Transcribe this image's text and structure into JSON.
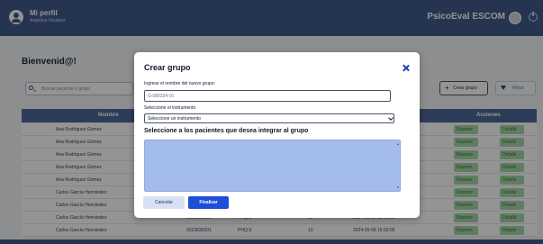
{
  "header": {
    "profile_title": "Mi perfil",
    "profile_subtitle": "Angelica Vazquez",
    "brand": "PsicoEval ESCOM"
  },
  "main": {
    "welcome": "Bienvenid@!",
    "search_placeholder": "Buscar paciente o grupo",
    "create_group_label": "Crear grupo",
    "filter_label": "Filtrar"
  },
  "table": {
    "headers": {
      "name": "Nombre",
      "actions": "Acciones"
    },
    "rows": [
      {
        "name": "Ana Rodríguez Gómez",
        "code": "",
        "instrument": "",
        "count": "",
        "date": "",
        "report": "Reporte",
        "detail": "Detalle"
      },
      {
        "name": "Ana Rodríguez Gómez",
        "code": "",
        "instrument": "",
        "count": "",
        "date": "",
        "report": "Reporte",
        "detail": "Detalle"
      },
      {
        "name": "Ana Rodríguez Gómez",
        "code": "",
        "instrument": "",
        "count": "",
        "date": "",
        "report": "Reporte",
        "detail": "Detalle"
      },
      {
        "name": "Ana Rodríguez Gómez",
        "code": "",
        "instrument": "",
        "count": "",
        "date": "",
        "report": "Reporte",
        "detail": "Detalle"
      },
      {
        "name": "Ana Rodríguez Gómez",
        "code": "",
        "instrument": "",
        "count": "",
        "date": "",
        "report": "Reporte",
        "detail": "Detalle"
      },
      {
        "name": "Carlos García Hernández",
        "code": "",
        "instrument": "",
        "count": "",
        "date": "",
        "report": "Reporte",
        "detail": "Detalle"
      },
      {
        "name": "Carlos García Hernández",
        "code": "",
        "instrument": "",
        "count": "",
        "date": "",
        "report": "Reporte",
        "detail": "Detalle"
      },
      {
        "name": "Carlos García Hernández",
        "code": "2023630001",
        "instrument": "PHQ-9",
        "count": "10",
        "date": "2024-05-09 15:00:00",
        "report": "Reporte",
        "detail": "Detalle"
      },
      {
        "name": "Carlos García Hernández",
        "code": "2023630001",
        "instrument": "PHQ-9",
        "count": "10",
        "date": "2024-05-09 15:00:00",
        "report": "Reporte",
        "detail": "Detalle"
      }
    ]
  },
  "modal": {
    "title": "Crear grupo",
    "name_label": "Ingrese el nombre del nuevo grupo:",
    "name_value": "G-080324-01",
    "instrument_label": "Seleccione el instrumento",
    "instrument_selected": "Seleccione un instrumento",
    "patients_label": "Seleccione a los pacientes que desea integrar al grupo",
    "cancel_label": "Cancelar",
    "finish_label": "Finalizar"
  }
}
